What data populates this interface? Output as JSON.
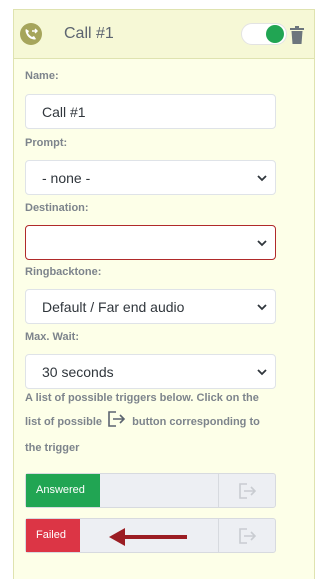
{
  "header": {
    "title": "Call #1",
    "icon": "phone-forward-icon",
    "toggle_on": true
  },
  "fields": {
    "name": {
      "label": "Name:",
      "value": "Call #1"
    },
    "prompt": {
      "label": "Prompt:",
      "value": "- none -"
    },
    "destination": {
      "label": "Destination:",
      "value": ""
    },
    "ringback": {
      "label": "Ringbacktone:",
      "value": "Default / Far end audio"
    },
    "maxwait": {
      "label": "Max. Wait:",
      "value": "30 seconds"
    }
  },
  "hint": {
    "part1": "A list of possible triggers below. Click on the list of possible",
    "part2": "button corresponding to the trigger"
  },
  "triggers": [
    {
      "label": "Answered",
      "color": "#21a553"
    },
    {
      "label": "Failed",
      "color": "#dc3545"
    }
  ],
  "colors": {
    "accent": "#21a553",
    "error": "#b02a2a",
    "arrow": "#9b1d23"
  }
}
